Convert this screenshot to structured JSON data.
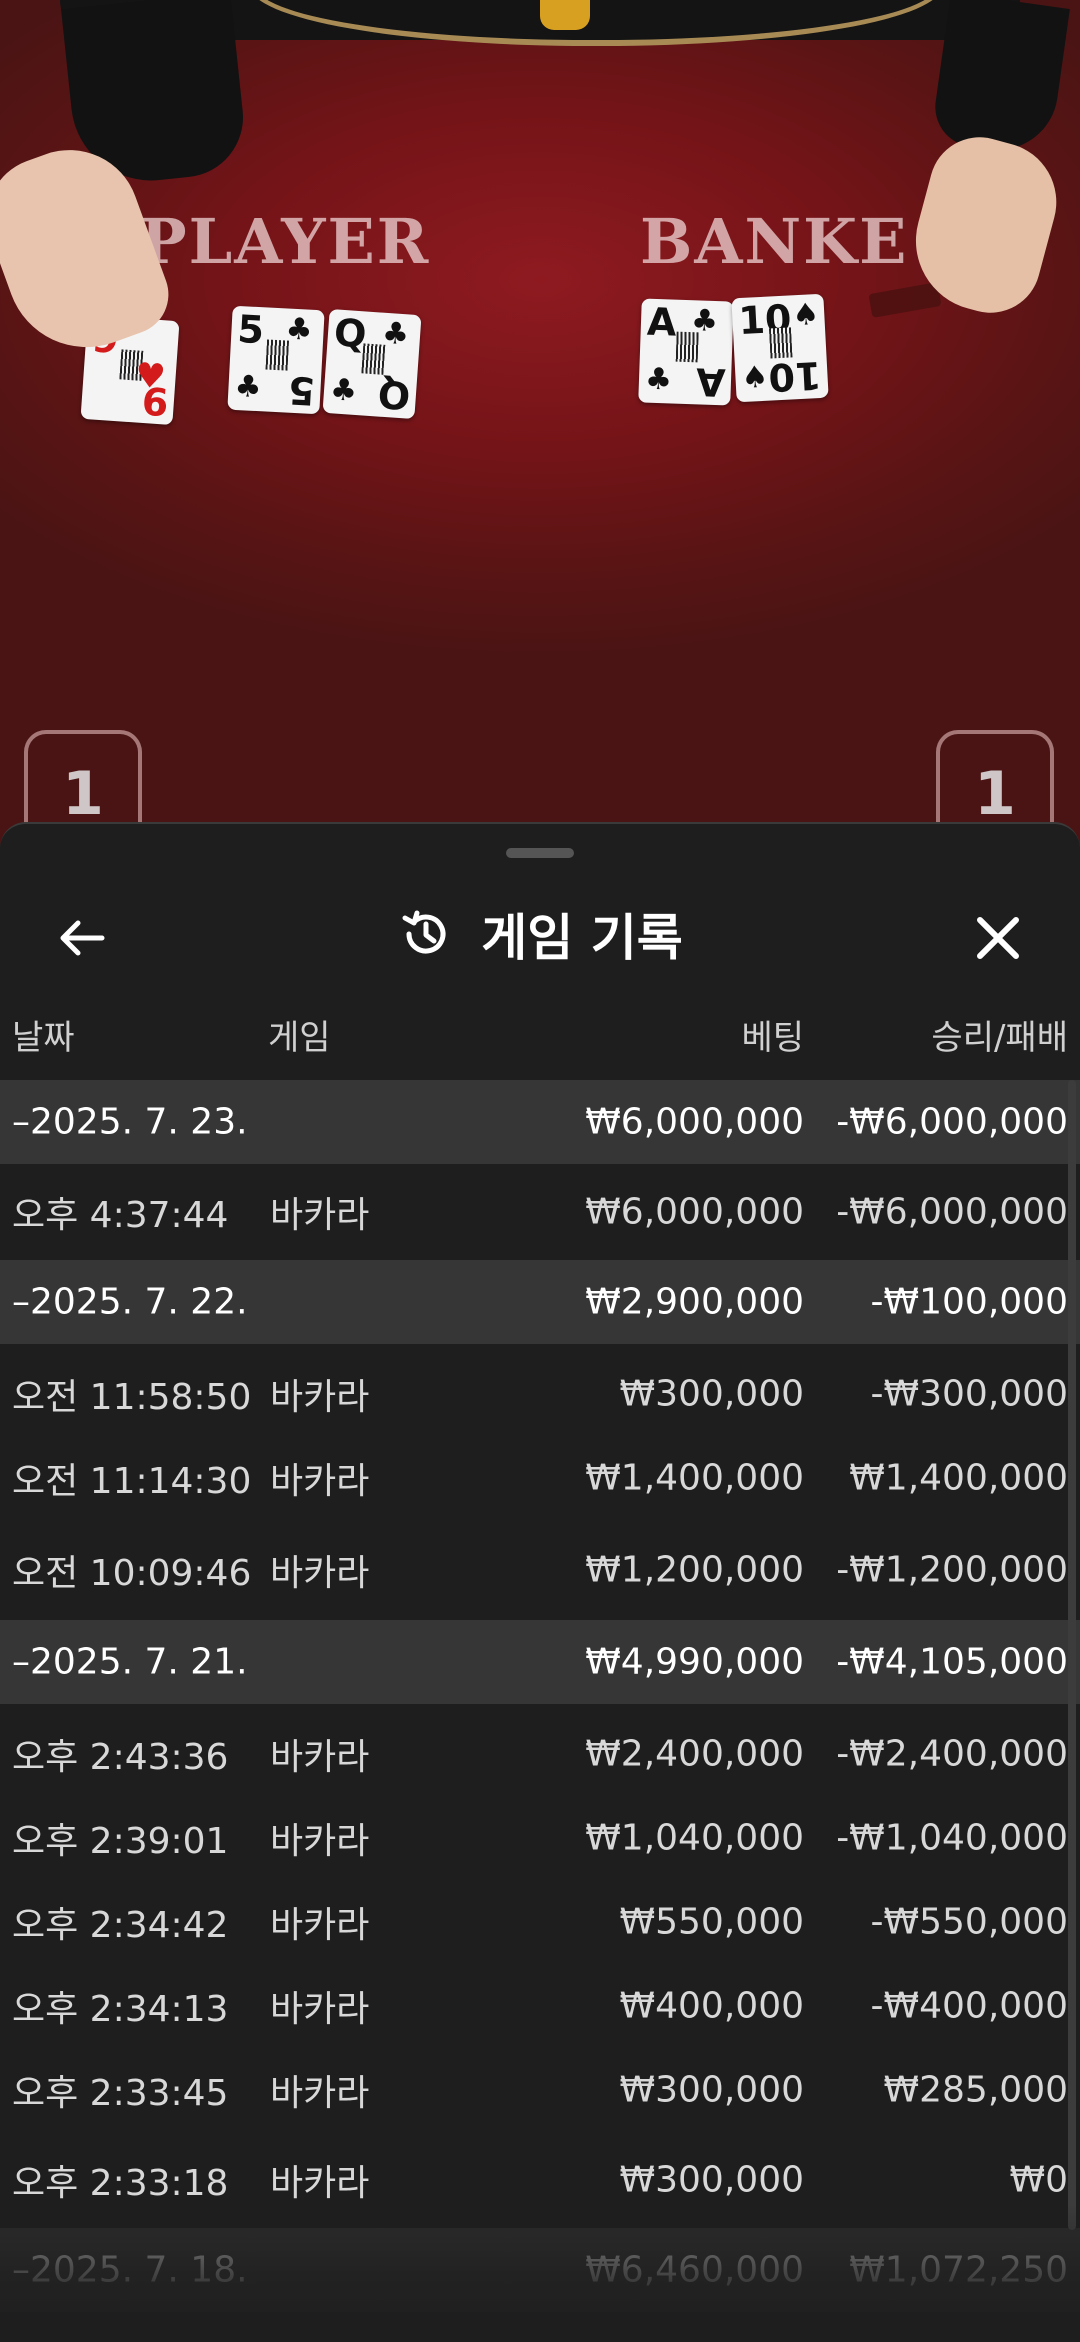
{
  "table": {
    "player_label": "PLAYER",
    "banker_label": "BANKE",
    "player_cards": [
      {
        "rank": "9",
        "color": "red"
      },
      {
        "rank": "5",
        "color": "black"
      },
      {
        "rank": "Q",
        "color": "black"
      }
    ],
    "banker_cards": [
      {
        "rank": "A",
        "color": "black"
      },
      {
        "rank": "10",
        "color": "black"
      }
    ],
    "player_score": "1",
    "banker_score": "1"
  },
  "sheet": {
    "title": "게임 기록",
    "back_icon": "arrow-left-icon",
    "history_icon": "history-icon",
    "close_icon": "close-icon",
    "columns": {
      "date": "날짜",
      "game": "게임",
      "bet": "베팅",
      "result": "승리/패배"
    },
    "groups": [
      {
        "date": "–2025. 7. 23.",
        "bet": "₩6,000,000",
        "result": "-₩6,000,000",
        "rows": [
          {
            "time": "오후 4:37:44",
            "game": "바카라",
            "bet": "₩6,000,000",
            "result": "-₩6,000,000"
          }
        ]
      },
      {
        "date": "–2025. 7. 22.",
        "bet": "₩2,900,000",
        "result": "-₩100,000",
        "rows": [
          {
            "time": "오전 11:58:50",
            "game": "바카라",
            "bet": "₩300,000",
            "result": "-₩300,000"
          },
          {
            "time": "오전 11:14:30",
            "game": "바카라",
            "bet": "₩1,400,000",
            "result": "₩1,400,000"
          },
          {
            "time": "오전 10:09:46",
            "game": "바카라",
            "bet": "₩1,200,000",
            "result": "-₩1,200,000"
          }
        ]
      },
      {
        "date": "–2025. 7. 21.",
        "bet": "₩4,990,000",
        "result": "-₩4,105,000",
        "rows": [
          {
            "time": "오후 2:43:36",
            "game": "바카라",
            "bet": "₩2,400,000",
            "result": "-₩2,400,000"
          },
          {
            "time": "오후 2:39:01",
            "game": "바카라",
            "bet": "₩1,040,000",
            "result": "-₩1,040,000"
          },
          {
            "time": "오후 2:34:42",
            "game": "바카라",
            "bet": "₩550,000",
            "result": "-₩550,000"
          },
          {
            "time": "오후 2:34:13",
            "game": "바카라",
            "bet": "₩400,000",
            "result": "-₩400,000"
          },
          {
            "time": "오후 2:33:45",
            "game": "바카라",
            "bet": "₩300,000",
            "result": "₩285,000"
          },
          {
            "time": "오후 2:33:18",
            "game": "바카라",
            "bet": "₩300,000",
            "result": "₩0"
          }
        ]
      },
      {
        "date": "–2025. 7. 18.",
        "bet": "₩6,460,000",
        "result": "₩1,072,250",
        "rows": []
      }
    ]
  }
}
